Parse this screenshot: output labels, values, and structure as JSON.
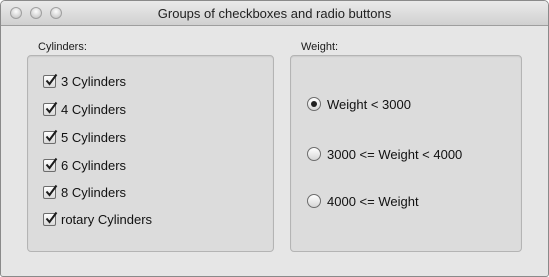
{
  "window": {
    "title": "Groups of checkboxes and radio buttons"
  },
  "cylinders_group": {
    "label": "Cylinders:",
    "items": [
      {
        "label": "3 Cylinders",
        "checked": true
      },
      {
        "label": "4 Cylinders",
        "checked": true
      },
      {
        "label": "5 Cylinders",
        "checked": true
      },
      {
        "label": "6 Cylinders",
        "checked": true
      },
      {
        "label": "8 Cylinders",
        "checked": true
      },
      {
        "label": "rotary Cylinders",
        "checked": true
      }
    ]
  },
  "weight_group": {
    "label": "Weight:",
    "options": [
      {
        "label": "Weight < 3000",
        "selected": true
      },
      {
        "label": "3000 <= Weight < 4000",
        "selected": false
      },
      {
        "label": "4000 <= Weight",
        "selected": false
      }
    ]
  }
}
